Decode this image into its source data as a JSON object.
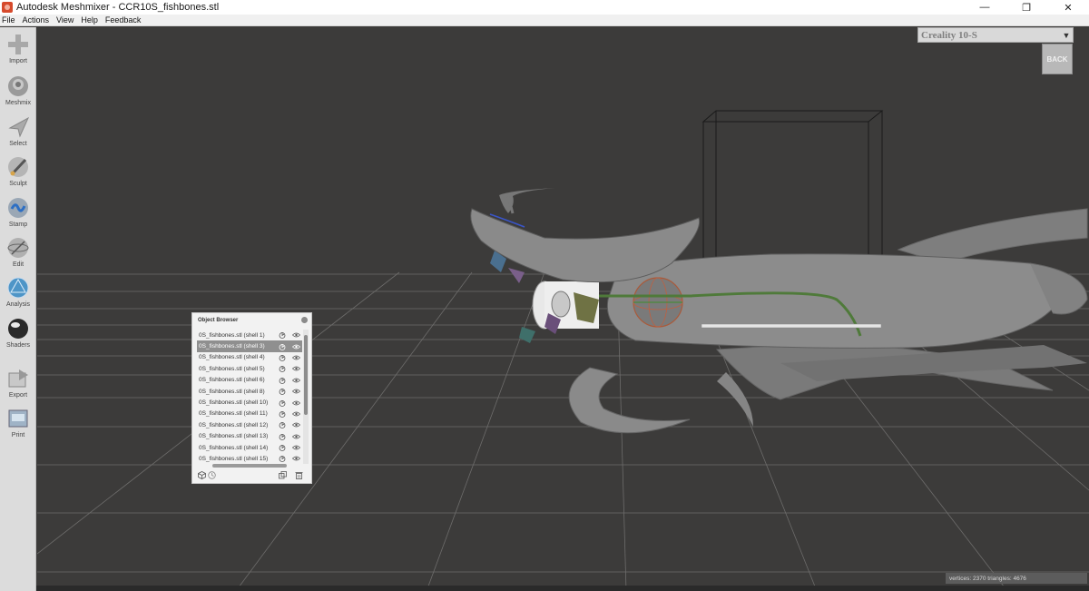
{
  "window": {
    "title": "Autodesk Meshmixer - CCR10S_fishbones.stl",
    "minimize": "—",
    "restore": "❐",
    "close": "✕"
  },
  "menu": [
    "File",
    "Actions",
    "View",
    "Help",
    "Feedback"
  ],
  "toolbar": [
    {
      "label": "Import",
      "icon": "plus-icon"
    },
    {
      "label": "Meshmix",
      "icon": "meshmix-icon"
    },
    {
      "label": "Select",
      "icon": "select-arrow-icon"
    },
    {
      "label": "Sculpt",
      "icon": "brush-icon"
    },
    {
      "label": "Stamp",
      "icon": "stamp-icon"
    },
    {
      "label": "Edit",
      "icon": "edit-sphere-icon"
    },
    {
      "label": "Analysis",
      "icon": "analysis-sphere-icon"
    },
    {
      "label": "Shaders",
      "icon": "shader-sphere-icon"
    },
    {
      "label": "Export",
      "icon": "export-icon"
    },
    {
      "label": "Print",
      "icon": "print-icon"
    }
  ],
  "printer": {
    "selected": "Creality 10-S",
    "back_label": "BACK"
  },
  "object_browser": {
    "title": "Object Browser",
    "items": [
      {
        "name": "0S_fishbones.stl (shell 1)",
        "selected": false
      },
      {
        "name": "0S_fishbones.stl (shell 3)",
        "selected": true
      },
      {
        "name": "0S_fishbones.stl (shell 4)",
        "selected": false
      },
      {
        "name": "0S_fishbones.stl (shell 5)",
        "selected": false
      },
      {
        "name": "0S_fishbones.stl (shell 6)",
        "selected": false
      },
      {
        "name": "0S_fishbones.stl (shell 8)",
        "selected": false
      },
      {
        "name": "0S_fishbones.stl (shell 10)",
        "selected": false
      },
      {
        "name": "0S_fishbones.stl (shell 11)",
        "selected": false
      },
      {
        "name": "0S_fishbones.stl (shell 12)",
        "selected": false
      },
      {
        "name": "0S_fishbones.stl (shell 13)",
        "selected": false
      },
      {
        "name": "0S_fishbones.stl (shell 14)",
        "selected": false
      },
      {
        "name": "0S_fishbones.stl (shell 15)",
        "selected": false
      }
    ]
  },
  "status": {
    "text": "vertices: 2370 triangles: 4676"
  },
  "colors": {
    "viewport_bg": "#3c3b3a",
    "grid": "#6a6968",
    "model": "#8a8a8a",
    "green_curve": "#4f7a3a"
  }
}
